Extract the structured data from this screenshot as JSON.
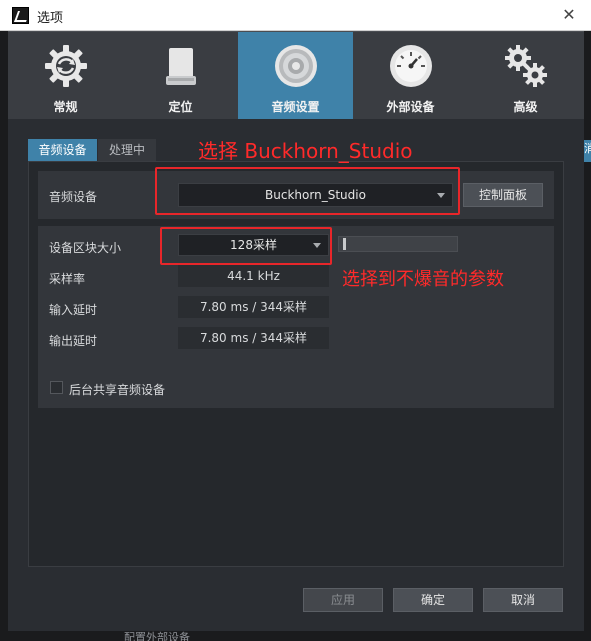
{
  "window": {
    "title": "选项",
    "close_glyph": "✕"
  },
  "topbar": {
    "items": [
      {
        "label": "常规",
        "icon": "gear-refresh-icon",
        "active": false
      },
      {
        "label": "定位",
        "icon": "drive-icon",
        "active": false
      },
      {
        "label": "音频设置",
        "icon": "speaker-icon",
        "active": true
      },
      {
        "label": "外部设备",
        "icon": "meter-icon",
        "active": false
      },
      {
        "label": "高级",
        "icon": "gears-icon",
        "active": false
      }
    ]
  },
  "subtabs": [
    {
      "label": "音频设备",
      "active": true
    },
    {
      "label": "处理中",
      "active": false
    }
  ],
  "device": {
    "label": "音频设备",
    "selected": "Buckhorn_Studio",
    "control_panel_label": "控制面板"
  },
  "settings": {
    "block_size_label": "设备区块大小",
    "block_size_value": "128采样",
    "sample_rate_label": "采样率",
    "sample_rate_value": "44.1 kHz",
    "input_latency_label": "输入延时",
    "input_latency_value": "7.80 ms / 344采样",
    "output_latency_label": "输出延时",
    "output_latency_value": "7.80 ms / 344采样",
    "share_label": "后台共享音频设备"
  },
  "annotations": {
    "select_device": "选择 Buckhorn_Studio",
    "select_params": "选择到不爆音的参数",
    "color": "#ff2a2a"
  },
  "footer": {
    "apply": "应用",
    "ok": "确定",
    "cancel": "取消"
  },
  "background": {
    "right_edge_text": "消",
    "bottom_text": "配置外部设备"
  },
  "colors": {
    "accent": "#3f82a9",
    "panel": "#2a2d32",
    "annotation_red": "#e8262a"
  }
}
